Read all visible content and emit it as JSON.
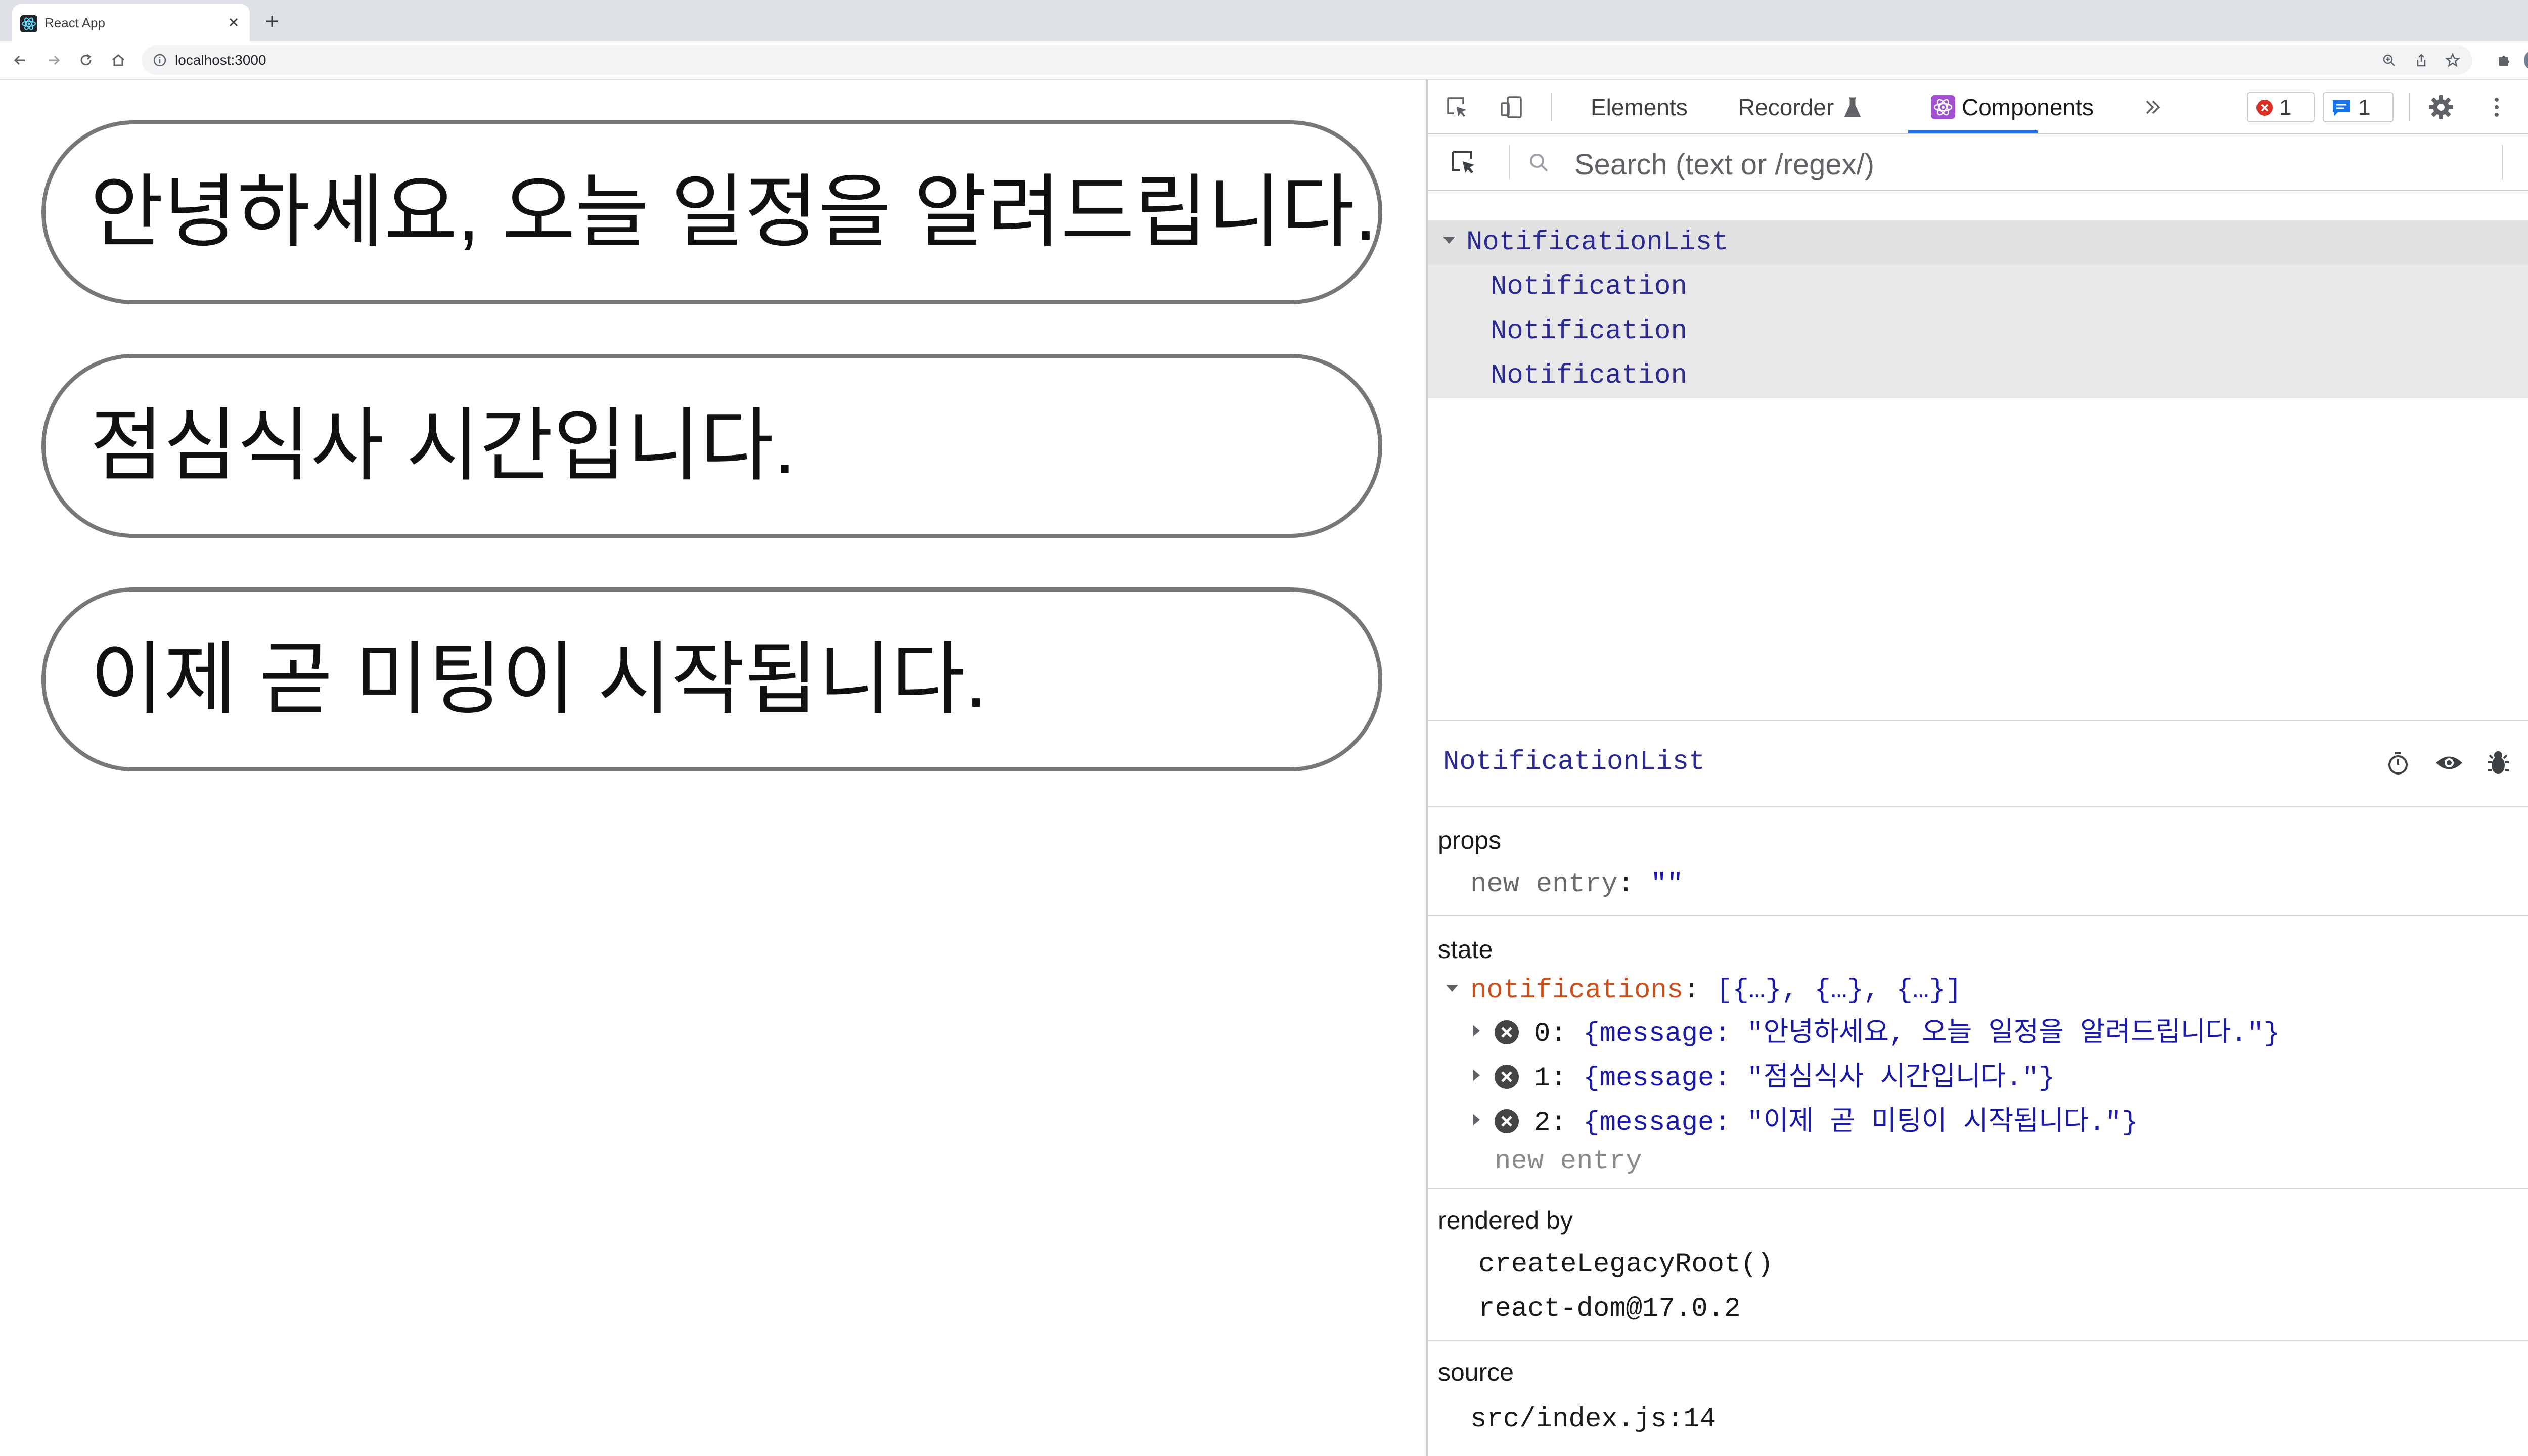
{
  "browser": {
    "tab_title": "React App",
    "url": "localhost:3000"
  },
  "page": {
    "notifications": [
      "안녕하세요, 오늘 일정을 알려드립니다.",
      "점심식사 시간입니다.",
      "이제 곧 미팅이 시작됩니다."
    ]
  },
  "devtools": {
    "tabs": [
      "Elements",
      "Recorder",
      "Components"
    ],
    "active_tab": "Components",
    "error_count": "1",
    "message_count": "1",
    "search_placeholder": "Search (text or /regex/)",
    "tree": {
      "root": "NotificationList",
      "children": [
        "Notification",
        "Notification",
        "Notification"
      ]
    },
    "inspector": {
      "component": "NotificationList",
      "props_title": "props",
      "props": [
        {
          "key": "new entry",
          "value": "\"\""
        }
      ],
      "state_title": "state",
      "state_key": "notifications",
      "state_summary": "[{…}, {…}, {…}]",
      "state_items": [
        {
          "index": "0:",
          "value": "{message: \"안녕하세요, 오늘 일정을 알려드립니다.\"}"
        },
        {
          "index": "1:",
          "value": "{message: \"점심식사 시간입니다.\"}"
        },
        {
          "index": "2:",
          "value": "{message: \"이제 곧 미팅이 시작됩니다.\"}"
        }
      ],
      "new_entry": "new entry",
      "rendered_by_title": "rendered by",
      "rendered_by": [
        "createLegacyRoot()",
        "react-dom@17.0.2"
      ],
      "source_title": "source",
      "source": "src/index.js:14"
    },
    "colors": {
      "component_name": "#2b2a8f",
      "state_key": "#c8501e",
      "accent": "#1a73e8",
      "error": "#d93025"
    }
  }
}
